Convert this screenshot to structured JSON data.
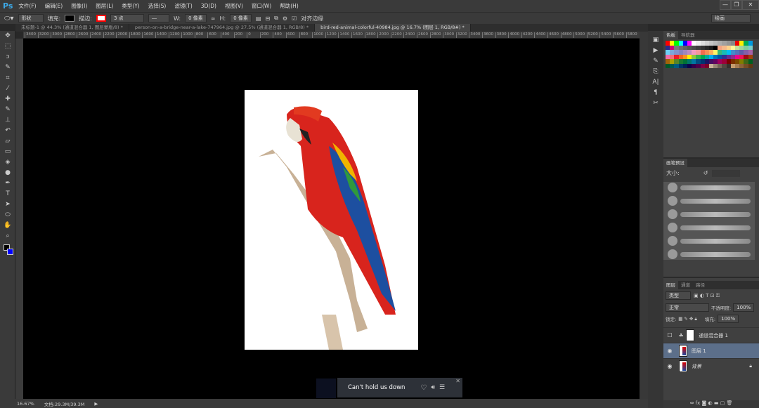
{
  "app": {
    "logo": "Ps",
    "menu": [
      "文件(F)",
      "编辑(E)",
      "图像(I)",
      "图层(L)",
      "类型(Y)",
      "选择(S)",
      "滤镜(T)",
      "3D(D)",
      "视图(V)",
      "窗口(W)",
      "帮助(H)"
    ],
    "window_buttons": [
      "—",
      "❐",
      "✕"
    ]
  },
  "options": {
    "shape_mode": "形状",
    "fill_label": "填充:",
    "stroke_label": "描边:",
    "stroke_width": "3 点",
    "w_label": "W:",
    "w_value": "0 像素",
    "h_label": "H:",
    "h_value": "0 像素",
    "align_edges": "对齐边缘",
    "workspace": "绘画",
    "fill_color": "#000000",
    "stroke_color": "#ff0000"
  },
  "tabs": [
    {
      "label": "未标题-1 @ 44.3% (通道混合器 1, 图层蒙版/8) *",
      "active": false
    },
    {
      "label": "person-on-a-bridge-near-a-lake-747964.jpg @ 27.5% (通道混合器 1, RGB/8) *",
      "active": false
    },
    {
      "label": "bird-red-animal-colorful-40984.jpg @ 16.7% (图层 1, RGB/8#) *",
      "active": true
    }
  ],
  "ruler": [
    "3400",
    "3200",
    "3000",
    "2800",
    "2600",
    "2400",
    "2200",
    "2000",
    "1800",
    "1600",
    "1400",
    "1200",
    "1000",
    "800",
    "600",
    "400",
    "200",
    "0",
    "200",
    "400",
    "600",
    "800",
    "1000",
    "1200",
    "1400",
    "1600",
    "1800",
    "2000",
    "2200",
    "2400",
    "2600",
    "2800",
    "3000",
    "3200",
    "3400",
    "3600",
    "3800",
    "4000",
    "4200",
    "4400",
    "4600",
    "4800",
    "5000",
    "5200",
    "5400",
    "5600",
    "5800"
  ],
  "tools": [
    "move",
    "marquee",
    "lasso",
    "quick-select",
    "crop",
    "eyedropper",
    "healing",
    "brush",
    "stamp",
    "history-brush",
    "eraser",
    "gradient",
    "blur",
    "dodge",
    "pen",
    "type",
    "path-select",
    "ellipse",
    "hand",
    "zoom"
  ],
  "status": {
    "zoom": "16.67%",
    "doc": "文档:29.3M/39.3M"
  },
  "swatches_panel": {
    "tabs": [
      "色板",
      "导航器"
    ],
    "colors": [
      "#ff0000",
      "#ffff00",
      "#00ff00",
      "#00ffff",
      "#0000ff",
      "#ff00ff",
      "#ffffff",
      "#eeeeee",
      "#dddddd",
      "#d0d0d0",
      "#c4c4c4",
      "#b8b8b8",
      "#acacac",
      "#a0a0a0",
      "#949494",
      "#888888",
      "#ee0000",
      "#ffee00",
      "#00aa55",
      "#0099dd",
      "#2a2a8a",
      "#cc0077",
      "#7a7a7a",
      "#6e6e6e",
      "#626262",
      "#565656",
      "#4a4a4a",
      "#3e3e3e",
      "#323232",
      "#262626",
      "#1a1a1a",
      "#000000",
      "#f4a383",
      "#f6b98a",
      "#fbd38b",
      "#fff799",
      "#c4df9b",
      "#a3d39c",
      "#82ca9d",
      "#7accc8",
      "#6dcff6",
      "#7da7d9",
      "#8393ca",
      "#8781bd",
      "#a186be",
      "#bd8cbf",
      "#f49ac1",
      "#f5989d",
      "#f26c4f",
      "#f68e56",
      "#fbaf5d",
      "#fff568",
      "#39b778",
      "#1abbb4",
      "#00bff3",
      "#438ccb",
      "#5574b9",
      "#605ca8",
      "#855fa8",
      "#a763a8",
      "#f06eaa",
      "#f26d7d",
      "#ed1c24",
      "#f26522",
      "#f7941d",
      "#fff200",
      "#8dc73f",
      "#39b54a",
      "#00a651",
      "#00a99d",
      "#00aeef",
      "#0072bc",
      "#0054a6",
      "#2e3192",
      "#662d91",
      "#92278f",
      "#ec008c",
      "#ed145b",
      "#9e0b0f",
      "#a0410d",
      "#a3620a",
      "#aba000",
      "#598527",
      "#197b30",
      "#007236",
      "#00746b",
      "#0076a3",
      "#004b80",
      "#003471",
      "#1b1464",
      "#440e62",
      "#630460",
      "#9e005d",
      "#9e0039",
      "#790000",
      "#7b2e00",
      "#7d4900",
      "#827b00",
      "#406618",
      "#005e20",
      "#005826",
      "#005952",
      "#005b7f",
      "#003663",
      "#002157",
      "#0d004c",
      "#32004b",
      "#4b0049",
      "#7b0046",
      "#7a0026",
      "#c7b299",
      "#998675",
      "#736357",
      "#534741",
      "#37302d",
      "#c69c6d",
      "#a67c52",
      "#8c6239",
      "#754c24",
      "#603913"
    ]
  },
  "brush_panel": {
    "tabs": [
      "画笔预设"
    ],
    "size_label": "大小:"
  },
  "layers_panel": {
    "tabs": [
      "图层",
      "通道",
      "路径"
    ],
    "filter": "类型",
    "blend_mode": "正常",
    "opacity_label": "不透明度:",
    "opacity": "100%",
    "lock_label": "锁定:",
    "fill_label": "填充:",
    "fill": "100%",
    "layers": [
      {
        "name": "通道混合器 1",
        "visible": false,
        "selected": false
      },
      {
        "name": "图层 1",
        "visible": true,
        "selected": true
      },
      {
        "name": "背景",
        "visible": true,
        "selected": false,
        "locked": true
      }
    ]
  },
  "media_popup": {
    "title": "Can't hold us down"
  }
}
